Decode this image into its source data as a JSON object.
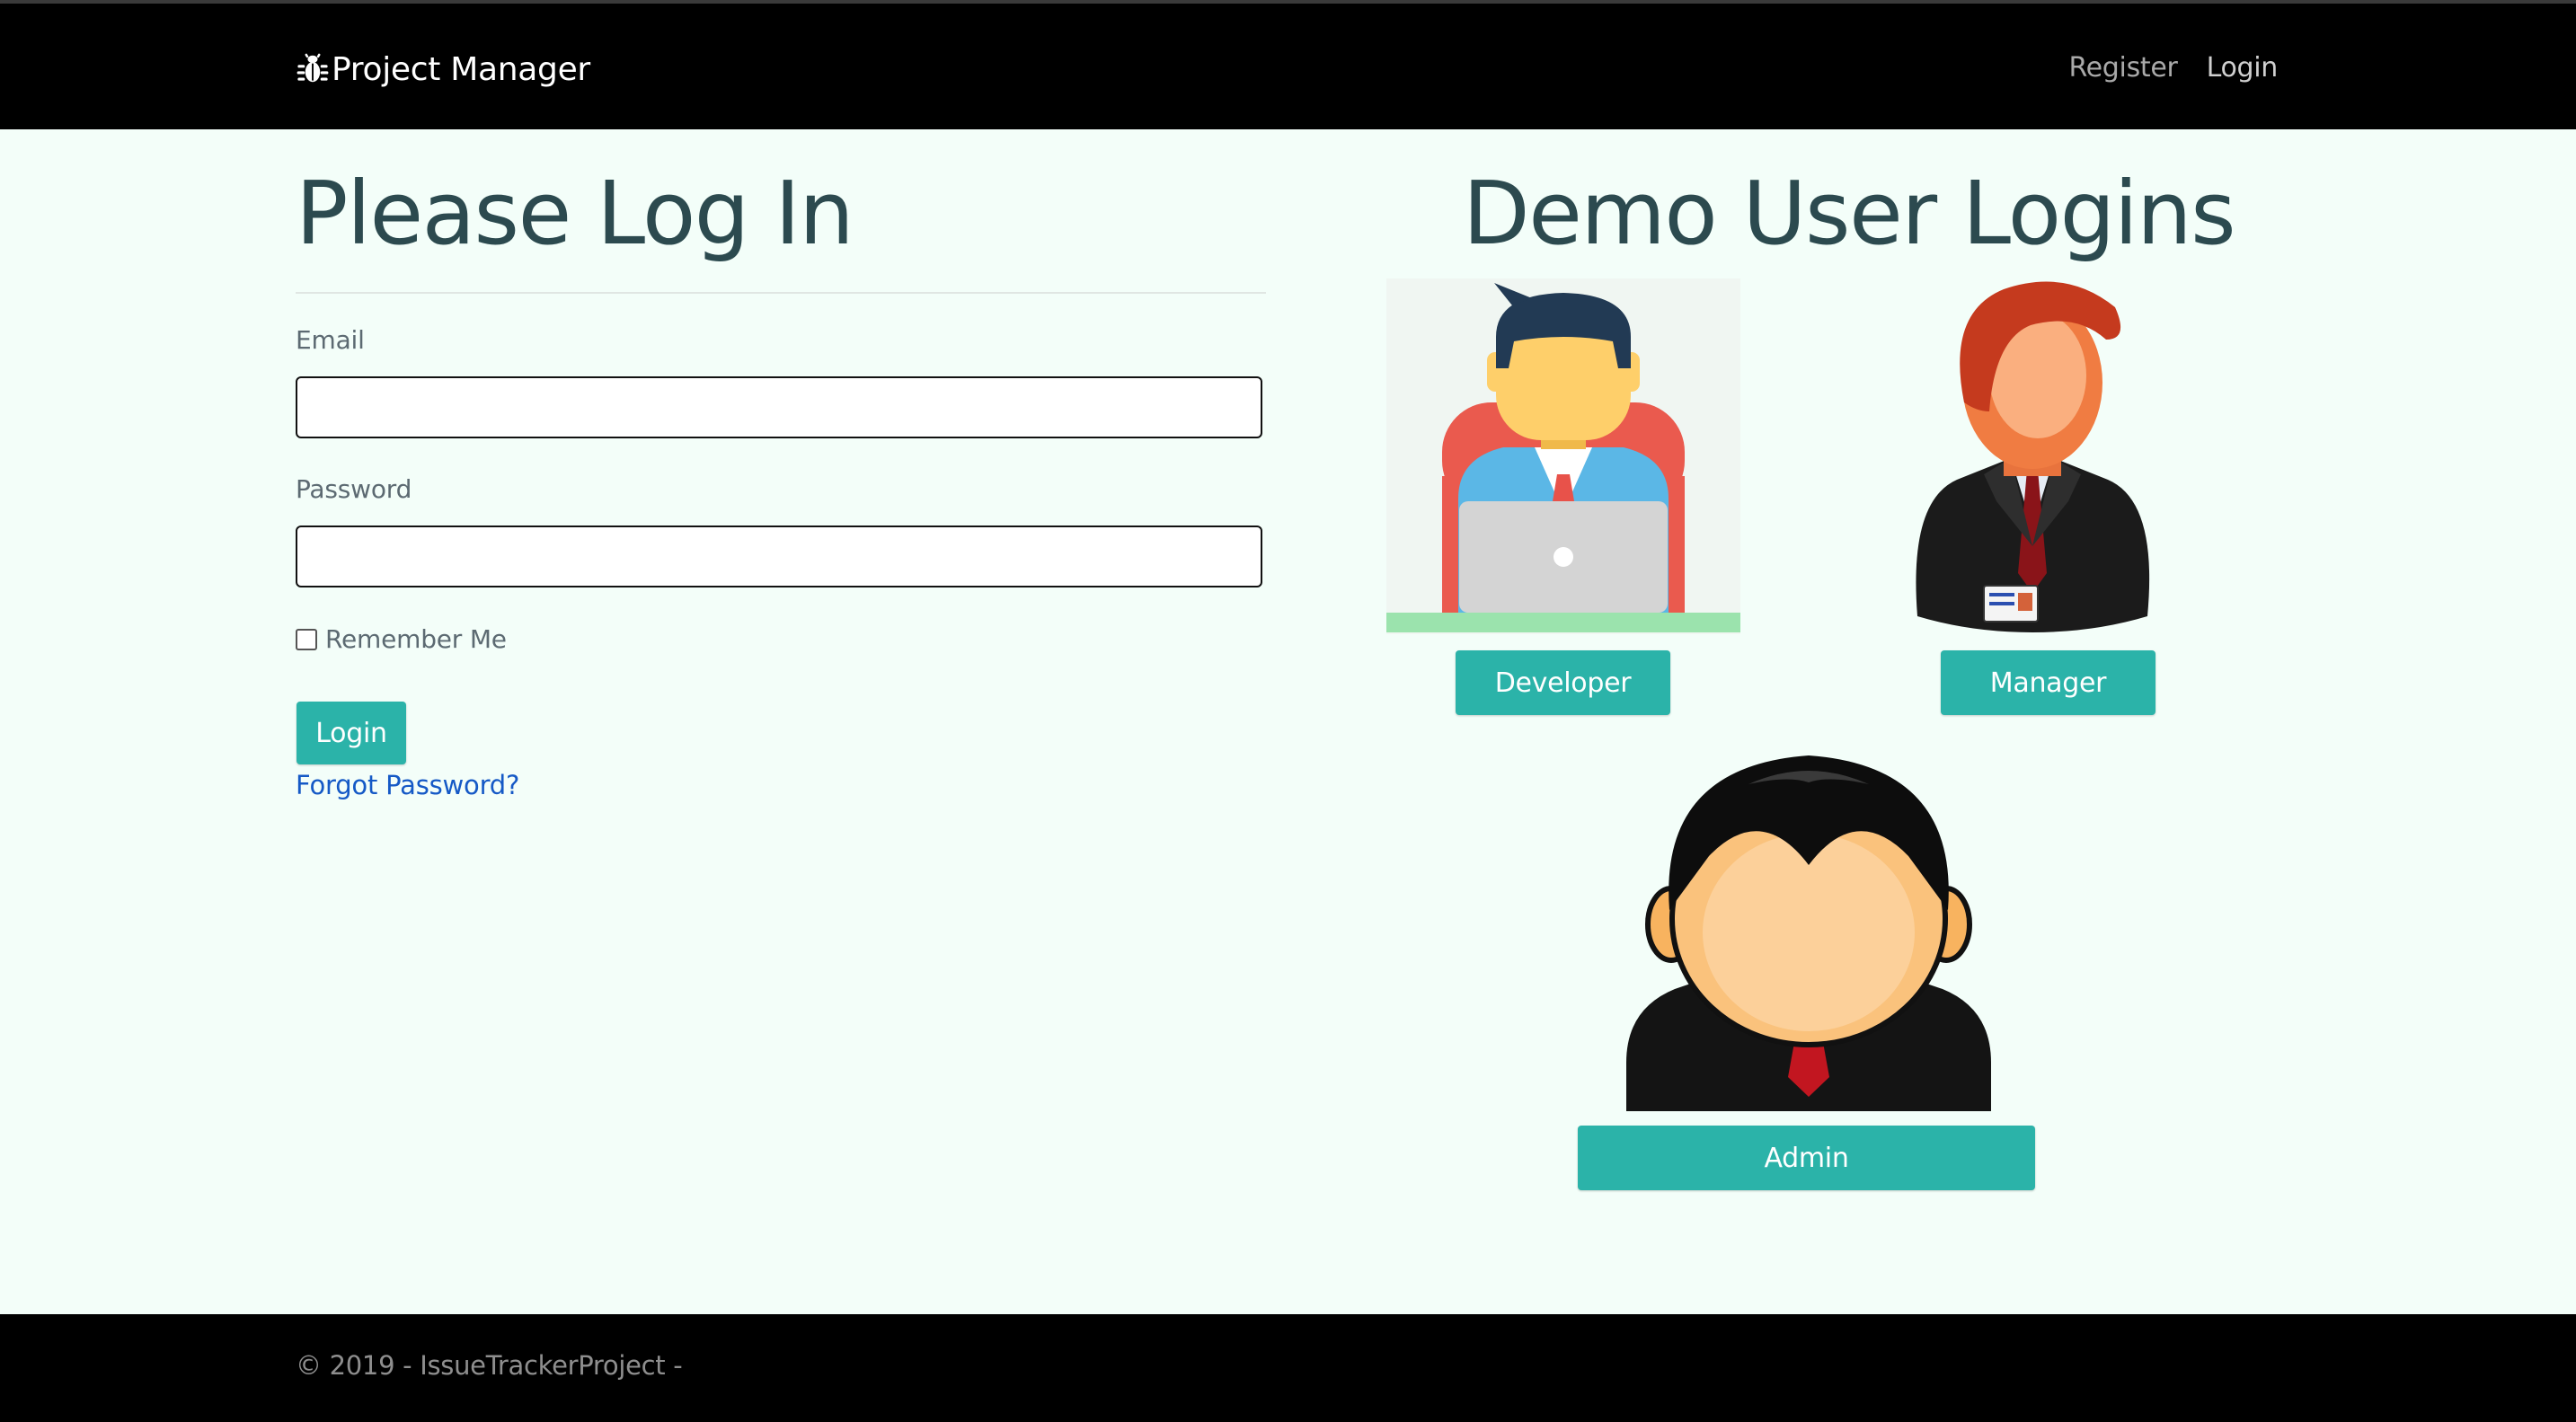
{
  "nav": {
    "brand": "Project Manager",
    "register": "Register",
    "login": "Login"
  },
  "login_form": {
    "title": "Please Log In",
    "email_label": "Email",
    "email_value": "",
    "password_label": "Password",
    "password_value": "",
    "remember_label": "Remember Me",
    "remember_checked": false,
    "login_button": "Login",
    "forgot_link": "Forgot Password?"
  },
  "demo": {
    "title": "Demo User Logins",
    "developer_button": "Developer",
    "manager_button": "Manager",
    "admin_button": "Admin"
  },
  "footer": {
    "text": "© 2019 - IssueTrackerProject -"
  },
  "colors": {
    "navbar": "#000000",
    "background": "#f3fef9",
    "accent": "#2bb3a9",
    "link": "#1559c6",
    "heading": "#2c4a4f"
  },
  "icons": {
    "brand": "bug-icon",
    "developer": "developer-avatar",
    "manager": "manager-avatar",
    "admin": "admin-avatar"
  }
}
